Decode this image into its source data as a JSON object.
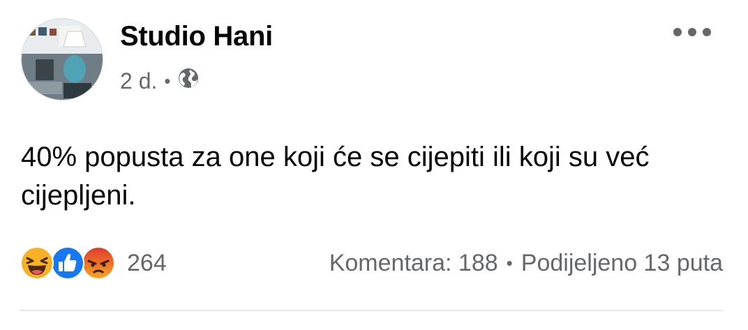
{
  "post": {
    "author": "Studio Hani",
    "time": "2 d.",
    "separator": "•",
    "privacy_icon": "globe-icon",
    "more_icon": "more-options-icon",
    "text": "40% popusta za one koji će se cijepiti ili koji su već cijepljeni."
  },
  "engagement": {
    "reactions": [
      "haha-reaction-icon",
      "like-reaction-icon",
      "angry-reaction-icon"
    ],
    "reaction_count": "264",
    "comments": "Komentara: 188",
    "separator": "•",
    "shares": "Podijeljeno 13 puta"
  },
  "colors": {
    "text_primary": "#050505",
    "text_secondary": "#65676b",
    "like_blue": "#1877f2",
    "haha_yellow": "#f7b125",
    "angry_orange": "#e9710f",
    "divider": "#e4e6eb"
  }
}
